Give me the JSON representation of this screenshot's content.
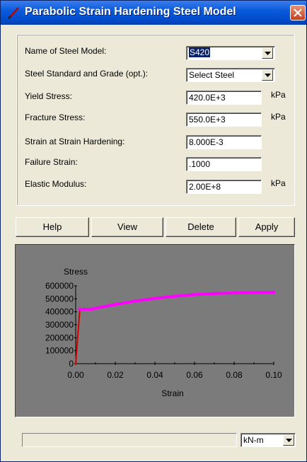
{
  "window": {
    "title": "Parabolic Strain Hardening Steel Model"
  },
  "form": {
    "model_name": {
      "label": "Name of Steel Model:",
      "value": "S420"
    },
    "steel_standard": {
      "label": "Steel Standard and Grade (opt.):",
      "value": "Select Steel"
    },
    "yield_stress": {
      "label": "Yield Stress:",
      "value": "420.0E+3",
      "unit": "kPa"
    },
    "fracture_stress": {
      "label": "Fracture Stress:",
      "value": "550.0E+3",
      "unit": "kPa"
    },
    "strain_hardening": {
      "label": "Strain at Strain Hardening:",
      "value": "8.000E-3"
    },
    "failure_strain": {
      "label": "Failure Strain:",
      "value": ".1000"
    },
    "elastic_modulus": {
      "label": "Elastic Modulus:",
      "value": "2.00E+8",
      "unit": "kPa"
    }
  },
  "buttons": {
    "help": "Help",
    "view": "View",
    "delete": "Delete",
    "apply": "Apply"
  },
  "chart_data": {
    "type": "line",
    "xlabel": "Strain",
    "ylabel": "Stress",
    "xlim": [
      0,
      0.1
    ],
    "ylim": [
      0,
      600000
    ],
    "x_ticks": [
      "0.00",
      "0.02",
      "0.04",
      "0.06",
      "0.08",
      "0.10"
    ],
    "y_ticks": [
      "0",
      "100000",
      "200000",
      "300000",
      "400000",
      "500000",
      "600000"
    ],
    "colors": {
      "curve": "#ff00ff",
      "elastic": "#d40000",
      "axis": "#000000",
      "background": "#7b7b7b"
    },
    "series": [
      {
        "color": "#d40000",
        "x": [
          0,
          0.0021
        ],
        "y": [
          0,
          420000
        ]
      },
      {
        "color": "#ff00ff",
        "x": [
          0.0021,
          0.008,
          0.01,
          0.02,
          0.03,
          0.04,
          0.05,
          0.06,
          0.07,
          0.08,
          0.09,
          0.1
        ],
        "y": [
          420000,
          420000,
          427000,
          456500,
          481900,
          503000,
          519900,
          532600,
          541000,
          545300,
          548500,
          550000
        ]
      }
    ]
  },
  "status": {
    "text": "",
    "units_value": "kN-m"
  }
}
